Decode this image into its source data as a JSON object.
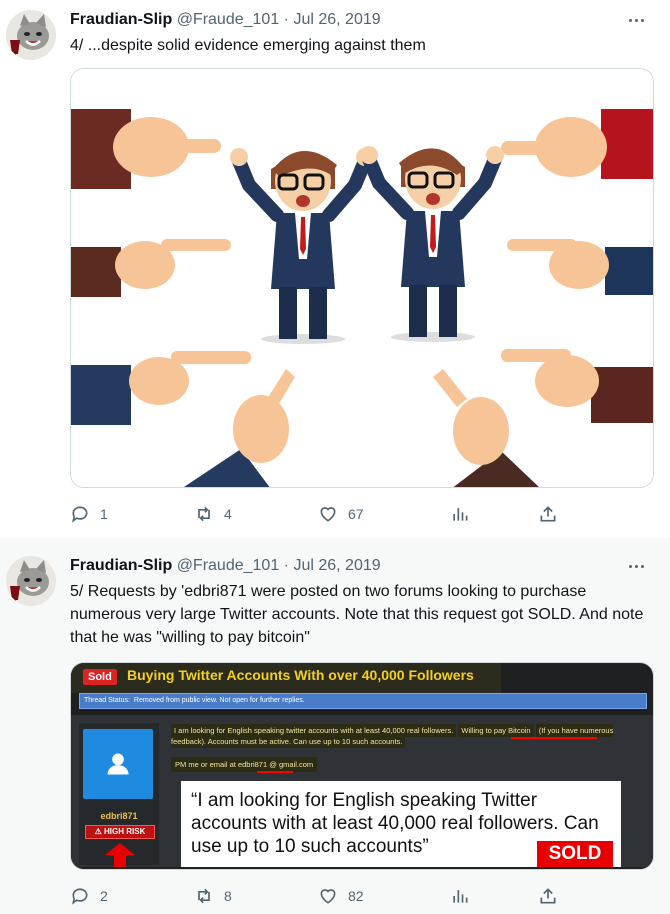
{
  "tweets": [
    {
      "name": "Fraudian-Slip",
      "handle": "@Fraude_101",
      "separator": "·",
      "date": "Jul 26, 2019",
      "text": "4/ ...despite solid evidence emerging against them",
      "media_description_icon": "cartoon-pointing-hands",
      "replies": "1",
      "retweets": "4",
      "likes": "67"
    },
    {
      "name": "Fraudian-Slip",
      "handle": "@Fraude_101",
      "separator": "·",
      "date": "Jul 26, 2019",
      "text": "5/ Requests by 'edbri871 were posted on two forums looking to purchase numerous very large Twitter accounts. Note that this request got SOLD. And note that he was \"willing to pay bitcoin\"",
      "replies": "2",
      "retweets": "8",
      "likes": "82",
      "forum": {
        "sold_tag": "Sold",
        "title": "Buying Twitter Accounts With over 40,000 Followers",
        "status_label": "Thread Status:",
        "status_text": "Removed from public view. Not open for further replies.",
        "post_line1": "I am looking for English speaking twitter accounts with at least 40,000 real followers.",
        "post_highlight": "Willing to pay Bitcoin",
        "post_line2": "(If you have numerous feedback). Accounts must be active. Can use up to 10 such accounts.",
        "email_prefix": "PM me or email at",
        "email_user": "edbri871",
        "email_suffix": "@ gmail.com",
        "username": "edbri871",
        "risk_label": "HIGH RISK",
        "quote": "“I am looking for English speaking Twitter accounts with at least 40,000 real followers. Can use up to 10 such accounts”",
        "sold_big": "SOLD"
      }
    }
  ],
  "colors": {
    "text_primary": "#0f1419",
    "text_secondary": "#536471",
    "thread_line": "#cfd9de",
    "forum_title": "#f4d020",
    "sold_red": "#e80000"
  }
}
